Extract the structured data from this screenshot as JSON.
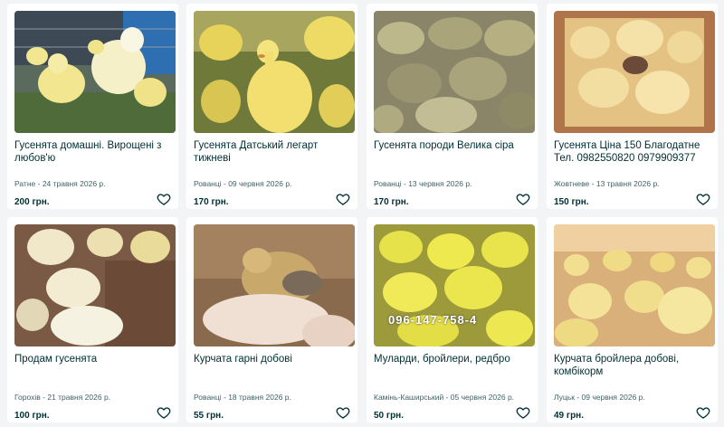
{
  "listings": [
    {
      "title": "Гусенята домашні. Вирощені з любов'ю",
      "location": "Ратне",
      "date": "24 травня 2026 р.",
      "price": "200 грн.",
      "image": "goslings-in-cage-photo"
    },
    {
      "title": "Гусенята Датський легарт тижневі",
      "location": "Рованці",
      "date": "09 червня 2026 р.",
      "price": "170 грн.",
      "image": "goslings-on-grass-photo"
    },
    {
      "title": "Гусенята породи Велика сіра",
      "location": "Рованці",
      "date": "13 червня 2026 р.",
      "price": "170 грн.",
      "image": "grey-goslings-flock-photo"
    },
    {
      "title": "Гусенята Ціна 150 Благодатне Тел. 0982550820 0979909377",
      "location": "Жовтневе",
      "date": "13 травня 2026 р.",
      "price": "150 грн.",
      "image": "goslings-in-box-photo"
    },
    {
      "title": "Продам гусенята",
      "location": "Горохів",
      "date": "21 травня 2026 р.",
      "price": "100 грн.",
      "image": "goslings-on-straw-photo"
    },
    {
      "title": "Курчата гарні добові",
      "location": "Рованці",
      "date": "18 травня 2026 р.",
      "price": "55 грн.",
      "image": "chick-in-hand-photo"
    },
    {
      "title": "Муларди, бройлери, редбро",
      "location": "Камінь-Каширський",
      "date": "05 червня 2026 р.",
      "price": "50 грн.",
      "image": "yellow-ducklings-photo",
      "watermark": "096-147-758-4"
    },
    {
      "title": "Курчата бройлера добові, комбікорм",
      "location": "Луцьк",
      "date": "09 червня 2026 р.",
      "price": "49 грн.",
      "image": "broiler-chicks-photo"
    }
  ],
  "separator": " - ",
  "colors": {
    "text": "#002f34",
    "meta": "#406367",
    "background": "#f2f4f5",
    "card": "#ffffff"
  },
  "icons": {
    "favorite": "heart-outline-icon"
  }
}
